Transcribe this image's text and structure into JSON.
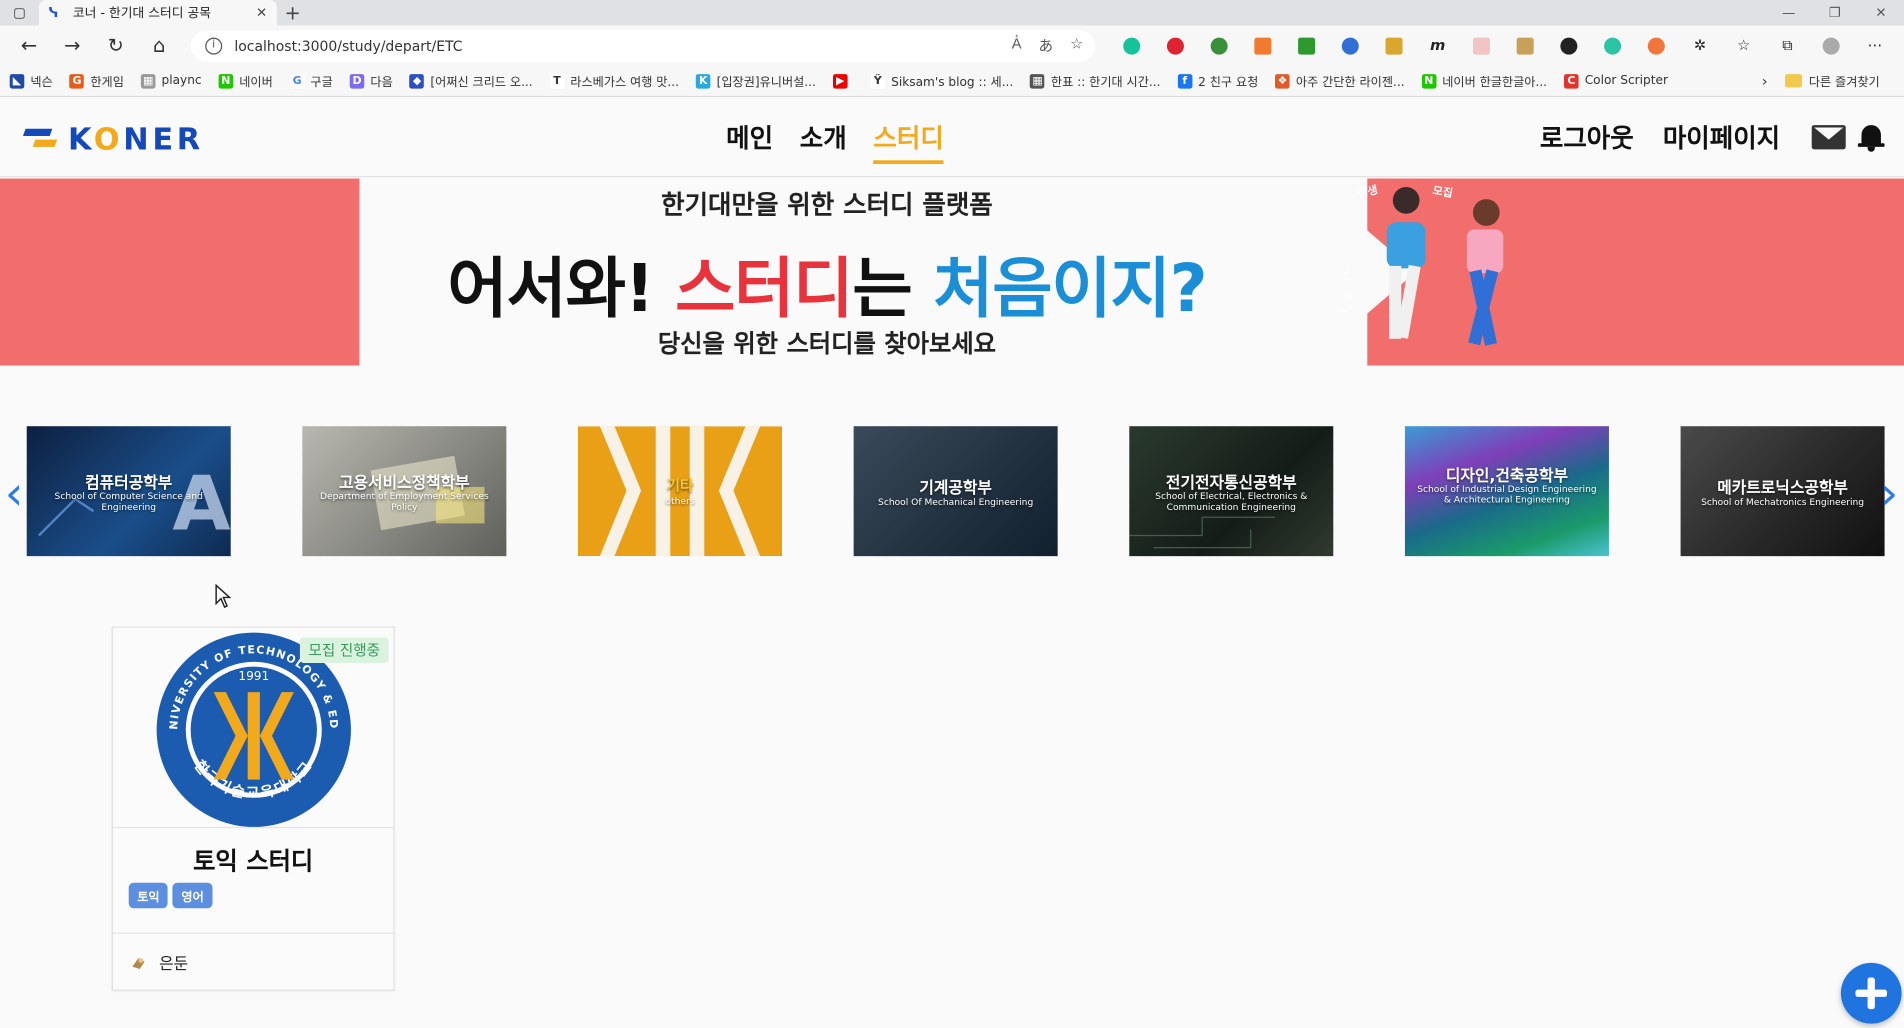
{
  "browser": {
    "tab_title": "코너 - 한기대 스터디 공목",
    "url": "localhost:3000/study/depart/ETC",
    "bookmarks": [
      "넥슨",
      "한게임",
      "plaync",
      "네이버",
      "구글",
      "다음",
      "[어쩌신 크리드 오...",
      "라스베가스 여행 맛...",
      "[입장권]유니버설...",
      "Siksam's blog :: 세...",
      "한표 :: 한기대 시간...",
      "2 친구 요청",
      "아주 간단한 라이젠...",
      "네이버 한글한글아...",
      "Color Scripter"
    ],
    "other_bookmarks": "다른 즐겨찾기"
  },
  "header": {
    "logo": "KONER",
    "nav": [
      "메인",
      "소개",
      "스터디"
    ],
    "active_nav": "스터디",
    "logout": "로그아웃",
    "mypage": "마이페이지"
  },
  "banner": {
    "top": "한기대만을 위한 스터디 플랫폼",
    "main_1": "어서와!",
    "main_red": "스터디",
    "main_2": "는",
    "main_blue": "처음이지?",
    "bottom": "당신을 위한 스터디를 찾아보세요",
    "tag_1": "학생",
    "tag_2": "모집"
  },
  "departments": [
    {
      "title": "컴퓨터공학부",
      "sub": "School of Computer Science and Engineering"
    },
    {
      "title": "고용서비스정책학부",
      "sub": "Department of Employment Services Policy"
    },
    {
      "title": "기타",
      "sub": "others"
    },
    {
      "title": "기계공학부",
      "sub": "School Of Mechanical Engineering"
    },
    {
      "title": "전기전자통신공학부",
      "sub": "School of Electrical, Electronics & Communication Engineering"
    },
    {
      "title": "디자인,건축공학부",
      "sub": "School of Industrial Design Engineering & Architectural Engineering"
    },
    {
      "title": "메카트로닉스공학부",
      "sub": "School of Mechatronics Engineering"
    }
  ],
  "study_card": {
    "badge": "모집 진행중",
    "title": "토익 스터디",
    "tags": [
      "토익",
      "영어"
    ],
    "author": "은둔",
    "seal_top": "KOREA UNIVERSITY OF TECHNOLOGY & EDUCATION",
    "seal_year": "1991",
    "seal_bottom": "한국기술교육대학교"
  },
  "colors": {
    "brand_blue": "#1548b8",
    "brand_orange": "#f2a91c",
    "banner_bg": "#f16e6c",
    "fab": "#1f74e0",
    "tag": "#5c8fe0"
  }
}
